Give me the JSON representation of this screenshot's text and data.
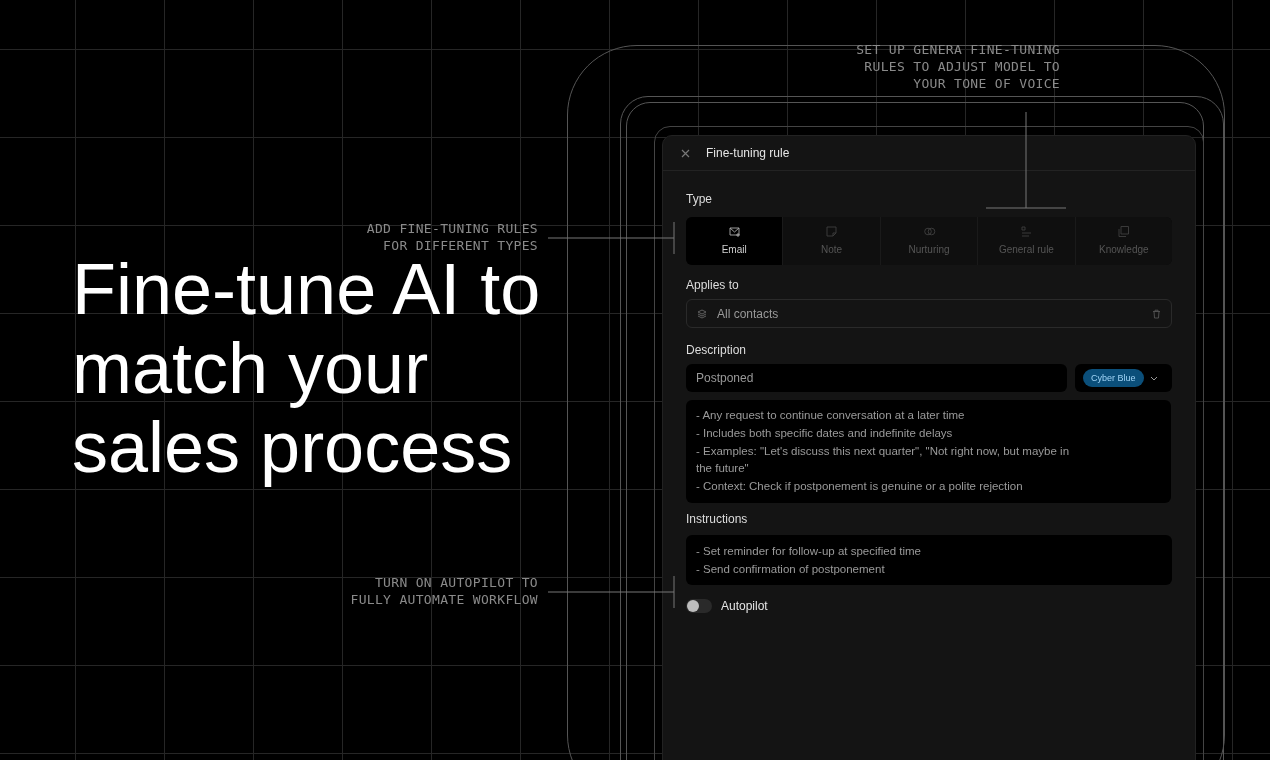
{
  "headline": "Fine-tune AI to match your sales process",
  "annotations": [
    {
      "text": "SET UP GENERA FINE-TUNING\nRULES TO ADJUST MODEL TO\nYOUR TONE OF VOICE"
    },
    {
      "text": "ADD FINE-TUNING RULES\nFOR DIFFERENT TYPES"
    },
    {
      "text": "TURN ON AUTOPILOT TO\nFULLY AUTOMATE WORKFLOW"
    }
  ],
  "panel": {
    "title": "Fine-tuning rule",
    "type_label": "Type",
    "types": [
      {
        "kind": "email",
        "label": "Email",
        "selected": true
      },
      {
        "kind": "note",
        "label": "Note",
        "selected": false
      },
      {
        "kind": "nurturing",
        "label": "Nurturing",
        "selected": false
      },
      {
        "kind": "general",
        "label": "General rule",
        "selected": false
      },
      {
        "kind": "knowledge",
        "label": "Knowledge",
        "selected": false
      }
    ],
    "applies_label": "Applies to",
    "applies_value": "All contacts",
    "description_label": "Description",
    "description_name": "Postponed",
    "tag": {
      "label": "Cyber Blue",
      "color": "#0b4f7a"
    },
    "description_lines": [
      "- Any request to continue conversation at a later time",
      "- Includes both specific dates and indefinite delays",
      "- Examples: \"Let's discuss this next quarter\", \"Not right now, but maybe in the future\"",
      "- Context: Check if postponement is genuine or a polite rejection"
    ],
    "instructions_label": "Instructions",
    "instruction_lines": [
      "- Set reminder for follow-up at specified time",
      "- Send confirmation of postponement"
    ],
    "autopilot": {
      "label": "Autopilot",
      "on": false
    }
  }
}
